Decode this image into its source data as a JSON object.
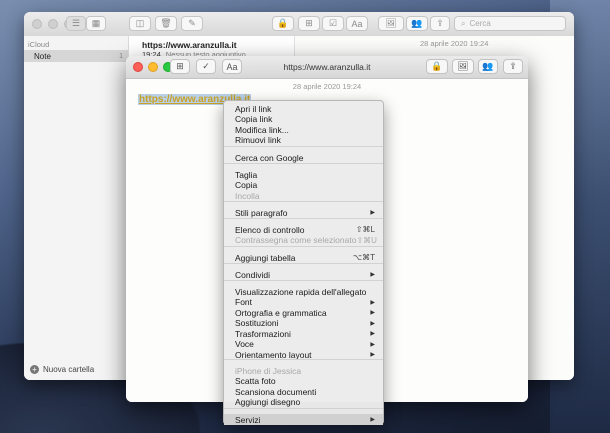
{
  "back_window": {
    "sidebar_header": "iCloud",
    "sidebar_item": "Note",
    "sidebar_item_count": "1",
    "new_folder_label": "Nuova cartella",
    "search_placeholder": "Cerca",
    "note_title": "https://www.aranzulla.it",
    "note_time": "19:24",
    "note_preview": "Nessun testo aggiuntivo",
    "editor_date": "28 aprile 2020 19:24"
  },
  "front_window": {
    "title": "https://www.aranzulla.it",
    "font_button": "Aa",
    "editor_date": "28 aprile 2020 19:24",
    "link_text": "https://www.aranzulla.it"
  },
  "context_menu": {
    "items": [
      {
        "label": "Apri il link"
      },
      {
        "label": "Copia link"
      },
      {
        "label": "Modifica link..."
      },
      {
        "label": "Rimuovi link"
      },
      {
        "label": "Cerca con Google"
      },
      {
        "label": "Taglia"
      },
      {
        "label": "Copia"
      },
      {
        "label": "Incolla",
        "disabled": true
      },
      {
        "label": "Stili paragrafo",
        "submenu": true
      },
      {
        "label": "Elenco di controllo",
        "shortcut": "⇧⌘L"
      },
      {
        "label": "Contrassegna come selezionato",
        "shortcut": "⇧⌘U",
        "disabled": true
      },
      {
        "label": "Aggiungi tabella",
        "shortcut": "⌥⌘T"
      },
      {
        "label": "Condividi",
        "submenu": true
      },
      {
        "label": "Visualizzazione rapida dell'allegato"
      },
      {
        "label": "Font",
        "submenu": true
      },
      {
        "label": "Ortografia e grammatica",
        "submenu": true
      },
      {
        "label": "Sostituzioni",
        "submenu": true
      },
      {
        "label": "Trasformazioni",
        "submenu": true
      },
      {
        "label": "Voce",
        "submenu": true
      },
      {
        "label": "Orientamento layout",
        "submenu": true
      },
      {
        "label": "iPhone di Jessica",
        "disabled": true
      },
      {
        "label": "Scatta foto"
      },
      {
        "label": "Scansiona documenti"
      },
      {
        "label": "Aggiungi disegno"
      },
      {
        "label": "Servizi",
        "submenu": true,
        "highlighted": true
      }
    ]
  },
  "colors": {
    "link": "#c9a227",
    "selection": "#b8cfe6",
    "close": "#fe5f57",
    "minimize": "#febc2e",
    "zoom": "#28c840"
  }
}
